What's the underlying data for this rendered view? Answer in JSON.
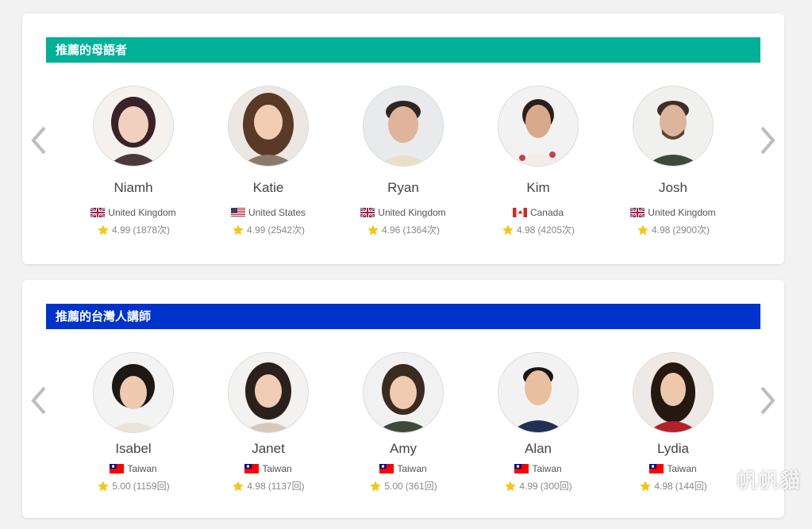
{
  "colors": {
    "native_header": "#00b098",
    "taiwan_header": "#0033cc",
    "star": "#f5c518",
    "arrow": "#bdbdbd"
  },
  "native_section": {
    "title": "推薦的母語者",
    "tutors": [
      {
        "name": "Niamh",
        "country": "United Kingdom",
        "flag": "uk-flag-icon",
        "score": "4.99",
        "count": "(1878次)"
      },
      {
        "name": "Katie",
        "country": "United States",
        "flag": "us-flag-icon",
        "score": "4.99",
        "count": "(2542次)"
      },
      {
        "name": "Ryan",
        "country": "United Kingdom",
        "flag": "uk-flag-icon",
        "score": "4.96",
        "count": "(1364次)"
      },
      {
        "name": "Kim",
        "country": "Canada",
        "flag": "canada-flag-icon",
        "score": "4.98",
        "count": "(4205次)"
      },
      {
        "name": "Josh",
        "country": "United Kingdom",
        "flag": "uk-flag-icon",
        "score": "4.98",
        "count": "(2900次)"
      }
    ]
  },
  "taiwan_section": {
    "title": "推薦的台灣人講師",
    "tutors": [
      {
        "name": "Isabel",
        "country": "Taiwan",
        "flag": "taiwan-flag-icon",
        "score": "5.00",
        "count": "(1159回)"
      },
      {
        "name": "Janet",
        "country": "Taiwan",
        "flag": "taiwan-flag-icon",
        "score": "4.98",
        "count": "(1137回)"
      },
      {
        "name": "Amy",
        "country": "Taiwan",
        "flag": "taiwan-flag-icon",
        "score": "5.00",
        "count": "(361回)"
      },
      {
        "name": "Alan",
        "country": "Taiwan",
        "flag": "taiwan-flag-icon",
        "score": "4.99",
        "count": "(300回)"
      },
      {
        "name": "Lydia",
        "country": "Taiwan",
        "flag": "taiwan-flag-icon",
        "score": "4.98",
        "count": "(144回)"
      }
    ]
  },
  "watermark": "帆帆貓"
}
